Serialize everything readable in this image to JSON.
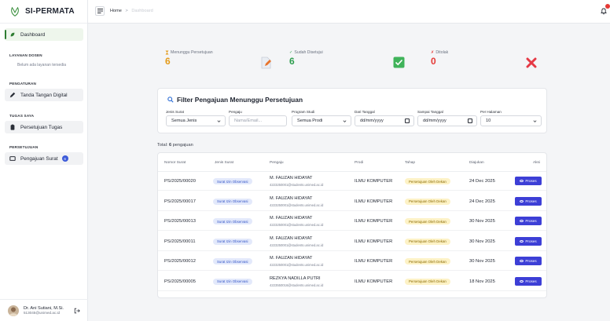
{
  "app": {
    "brand": "SI-PERMATA"
  },
  "sidebar": {
    "dashboard": "Dashboard",
    "sections": [
      {
        "title": "LAYANAN DOSEN",
        "note": "Belum ada layanan tersedia"
      },
      {
        "title": "PENGATURAN",
        "item": "Tanda Tangan Digital"
      },
      {
        "title": "TUGAS SAYA",
        "item": "Persetujuan Tugas"
      },
      {
        "title": "PERSETUJUAN",
        "item": "Pengajuan Surat",
        "badge": "6"
      }
    ],
    "user": {
      "name": "Dr. Ani Sutiani, M.Si.",
      "email": "513045@unimed.ac.id"
    }
  },
  "topbar": {
    "home": "Home",
    "separator": ">",
    "current": "Dashboard",
    "notifications": 1
  },
  "stats": [
    {
      "label": "Menunggu Persetujuan",
      "value": "6",
      "color": "#e39b1a"
    },
    {
      "label": "Sudah Disetujui",
      "value": "6",
      "color": "#2e9e4f"
    },
    {
      "label": "Ditolak",
      "value": "0",
      "color": "#e53935"
    }
  ],
  "filter": {
    "title": "Filter Pengajuan Menunggu Persetujuan",
    "labels": {
      "jenis": "Jenis Surat",
      "pengaju": "Pengaju",
      "prodi": "Program Studi",
      "dari": "Dari Tanggal",
      "sampai": "Sampai Tanggal",
      "per": "Per Halaman"
    },
    "values": {
      "jenis": "Semua Jenis",
      "pengaju_placeholder": "Nama/Email...",
      "prodi": "Semua Prodi",
      "dari": "dd/mm/yyyy",
      "sampai": "dd/mm/yyyy",
      "per": "10"
    }
  },
  "total": {
    "prefix": "Total:",
    "count": "6",
    "suffix": "pengajuan"
  },
  "table": {
    "headers": [
      "Nomor Surat",
      "Jenis Surat",
      "Pengaju",
      "Prodi",
      "Tahap",
      "Diajukan",
      "Aksi"
    ],
    "action_label": "Proses",
    "rows": [
      {
        "nomor": "PS/2025/00020",
        "jenis": "Surat Izin Observasi",
        "nama": "M. FAUZAN HIDAYAT",
        "email": "4223250001@students.unimed.ac.id",
        "prodi": "ILMU KOMPUTER",
        "tahap": "Persetujuan Oleh Dekan",
        "tanggal": "24 Dec 2025"
      },
      {
        "nomor": "PS/2025/00017",
        "jenis": "Surat Izin Observasi",
        "nama": "M. FAUZAN HIDAYAT",
        "email": "4223250001@students.unimed.ac.id",
        "prodi": "ILMU KOMPUTER",
        "tahap": "Persetujuan Oleh Dekan",
        "tanggal": "24 Dec 2025"
      },
      {
        "nomor": "PS/2025/00013",
        "jenis": "Surat Izin Observasi",
        "nama": "M. FAUZAN HIDAYAT",
        "email": "4223250001@students.unimed.ac.id",
        "prodi": "ILMU KOMPUTER",
        "tahap": "Persetujuan Oleh Dekan",
        "tanggal": "30 Nov 2025"
      },
      {
        "nomor": "PS/2025/00011",
        "jenis": "Surat Izin Observasi",
        "nama": "M. FAUZAN HIDAYAT",
        "email": "4223250001@students.unimed.ac.id",
        "prodi": "ILMU KOMPUTER",
        "tahap": "Persetujuan Oleh Dekan",
        "tanggal": "30 Nov 2025"
      },
      {
        "nomor": "PS/2025/00012",
        "jenis": "Surat Izin Observasi",
        "nama": "M. FAUZAN HIDAYAT",
        "email": "4223250001@students.unimed.ac.id",
        "prodi": "ILMU KOMPUTER",
        "tahap": "Persetujuan Oleh Dekan",
        "tanggal": "30 Nov 2025"
      },
      {
        "nomor": "PS/2025/00005",
        "jenis": "Surat Izin Observasi",
        "nama": "REZKYA NADILLA PUTRI",
        "email": "4223550016@students.unimed.ac.id",
        "prodi": "ILMU KOMPUTER",
        "tahap": "Persetujuan Oleh Dekan",
        "tanggal": "18 Nov 2025"
      }
    ]
  }
}
